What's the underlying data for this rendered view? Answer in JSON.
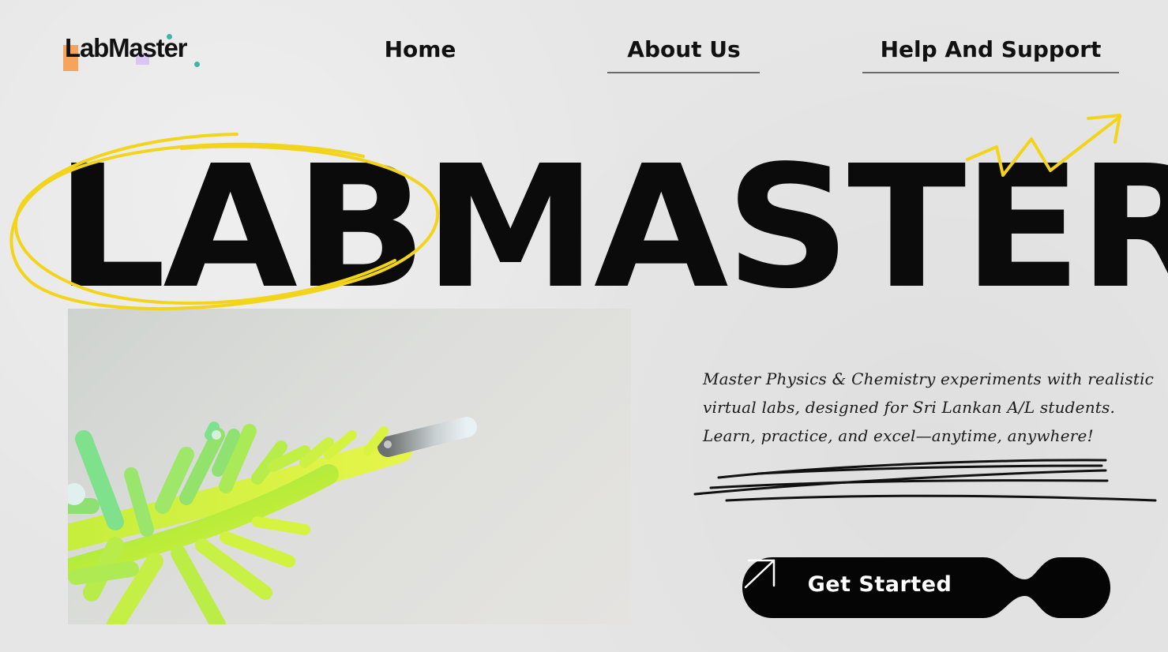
{
  "brand": {
    "logo_text": "LabMaster",
    "colors": {
      "orange": "#f6a35c",
      "purple": "#d9c7f2",
      "teal": "#3fb3a6"
    }
  },
  "nav": {
    "items": [
      {
        "label": "Home"
      },
      {
        "label": "About Us"
      },
      {
        "label": "Help And Support"
      }
    ]
  },
  "hero": {
    "title": "LABMASTER",
    "accent_color": "#f2d41a",
    "image_description_icon": "green-molecule-image"
  },
  "tagline": {
    "lines": [
      "Master Physics & Chemistry experiments with realistic",
      "virtual labs, designed for Sri Lankan A/L students.",
      "Learn, practice, and excel—anytime, anywhere!"
    ]
  },
  "cta": {
    "label": "Get Started",
    "icon": "arrow-up-right-icon"
  }
}
